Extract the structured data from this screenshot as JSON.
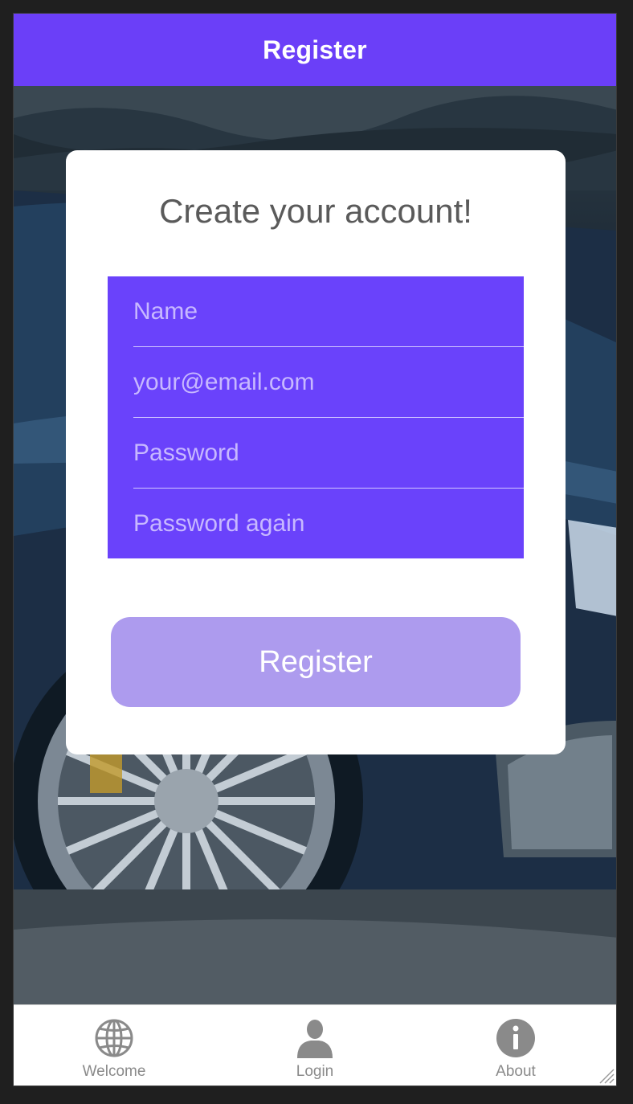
{
  "nav": {
    "title": "Register"
  },
  "card": {
    "title": "Create your account!",
    "fields": [
      {
        "placeholder": "Name",
        "value": ""
      },
      {
        "placeholder": "your@email.com",
        "value": ""
      },
      {
        "placeholder": "Password",
        "value": ""
      },
      {
        "placeholder": "Password again",
        "value": ""
      }
    ],
    "submit_label": "Register"
  },
  "tabs": [
    {
      "label": "Welcome",
      "icon": "globe-icon"
    },
    {
      "label": "Login",
      "icon": "user-icon"
    },
    {
      "label": "About",
      "icon": "info-icon"
    }
  ],
  "colors": {
    "accent": "#6b3ff8",
    "form_bg": "#6a42fb",
    "button_bg": "#ad9bee",
    "tab_icon": "#8a8a8a"
  }
}
